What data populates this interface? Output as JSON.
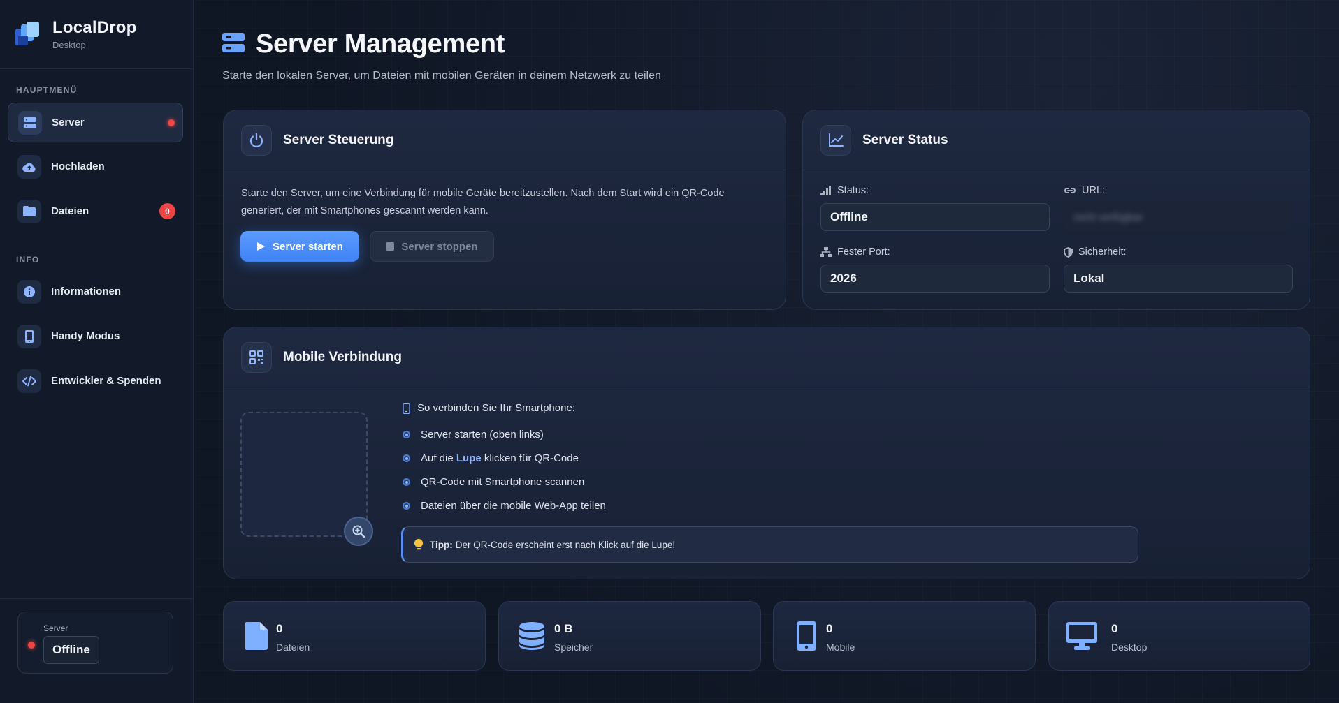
{
  "app": {
    "title": "LocalDrop",
    "subtitle": "Desktop"
  },
  "sidebar": {
    "section_main": "HAUPTMENÜ",
    "section_info": "INFO",
    "items": [
      {
        "label": "Server",
        "icon": "server-icon",
        "active": true,
        "indicator": "red-dot"
      },
      {
        "label": "Hochladen",
        "icon": "cloud-upload-icon"
      },
      {
        "label": "Dateien",
        "icon": "folder-icon",
        "badge": "0"
      },
      {
        "label": "Informationen",
        "icon": "info-icon"
      },
      {
        "label": "Handy Modus",
        "icon": "phone-icon"
      },
      {
        "label": "Entwickler & Spenden",
        "icon": "code-icon"
      }
    ],
    "server_status": {
      "label": "Server",
      "value": "Offline"
    }
  },
  "header": {
    "title": "Server Management",
    "subtitle": "Starte den lokalen Server, um Dateien mit mobilen Geräten in deinem Netzwerk zu teilen"
  },
  "control": {
    "title": "Server Steuerung",
    "description": "Starte den Server, um eine Verbindung für mobile Geräte bereitzustellen. Nach dem Start wird ein QR-Code generiert, der mit Smartphones gescannt werden kann.",
    "start_label": "Server starten",
    "stop_label": "Server stoppen"
  },
  "status": {
    "title": "Server Status",
    "status_label": "Status:",
    "status_value": "Offline",
    "url_label": "URL:",
    "url_value": "nicht verfügbar",
    "port_label": "Fester Port:",
    "port_value": "2026",
    "security_label": "Sicherheit:",
    "security_value": "Lokal"
  },
  "mobile": {
    "title": "Mobile Verbindung",
    "steps_title": "So verbinden Sie Ihr Smartphone:",
    "step1": "Server starten (oben links)",
    "step2_pre": "Auf die ",
    "step2_bold": "Lupe",
    "step2_post": " klicken für QR-Code",
    "step3": "QR-Code mit Smartphone scannen",
    "step4": "Dateien über die mobile Web-App teilen",
    "tip_label": "Tipp:",
    "tip_text": "Der QR-Code erscheint erst nach Klick auf die Lupe!"
  },
  "stats": [
    {
      "value": "0",
      "label": "Dateien",
      "icon": "file-icon"
    },
    {
      "value": "0 B",
      "label": "Speicher",
      "icon": "database-icon"
    },
    {
      "value": "0",
      "label": "Mobile",
      "icon": "mobile-icon"
    },
    {
      "value": "0",
      "label": "Desktop",
      "icon": "desktop-icon"
    }
  ],
  "colors": {
    "accent": "#4a8cf7",
    "danger": "#ef4444",
    "background": "#0f1624",
    "card": "#1a2336"
  }
}
